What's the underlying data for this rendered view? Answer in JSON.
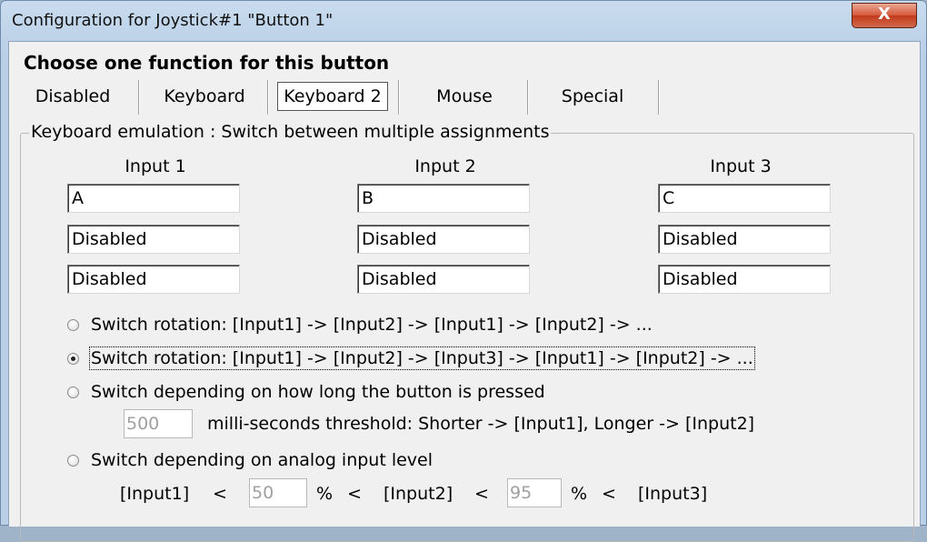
{
  "window": {
    "title": "Configuration for Joystick#1 \"Button 1\"",
    "close_label": "X"
  },
  "heading": "Choose one function for this button",
  "tabs": [
    {
      "label": "Disabled",
      "selected": false
    },
    {
      "label": "Keyboard",
      "selected": false
    },
    {
      "label": "Keyboard 2",
      "selected": true
    },
    {
      "label": "Mouse",
      "selected": false
    },
    {
      "label": "Special",
      "selected": false
    }
  ],
  "group": {
    "legend": "Keyboard emulation : Switch between multiple assignments",
    "columns": [
      {
        "header": "Input 1",
        "fields": [
          "A",
          "Disabled",
          "Disabled"
        ]
      },
      {
        "header": "Input 2",
        "fields": [
          "B",
          "Disabled",
          "Disabled"
        ]
      },
      {
        "header": "Input 3",
        "fields": [
          "C",
          "Disabled",
          "Disabled"
        ]
      }
    ]
  },
  "options": [
    {
      "label": "Switch rotation: [Input1] -> [Input2] -> [Input1] -> [Input2] -> ...",
      "checked": false
    },
    {
      "label": "Switch rotation: [Input1] -> [Input2] -> [Input3] -> [Input1] -> [Input2] -> ...",
      "checked": true
    },
    {
      "label": "Switch depending on how long the button is pressed",
      "checked": false
    },
    {
      "label": "Switch depending on analog input level",
      "checked": false
    }
  ],
  "threshold": {
    "value": "500",
    "label": "milli-seconds threshold: Shorter -> [Input1], Longer -> [Input2]"
  },
  "analog": {
    "input1": "[Input1]",
    "lt": "<",
    "value1": "50",
    "pct": "%",
    "input2": "[Input2]",
    "value2": "95",
    "input3": "[Input3]"
  }
}
